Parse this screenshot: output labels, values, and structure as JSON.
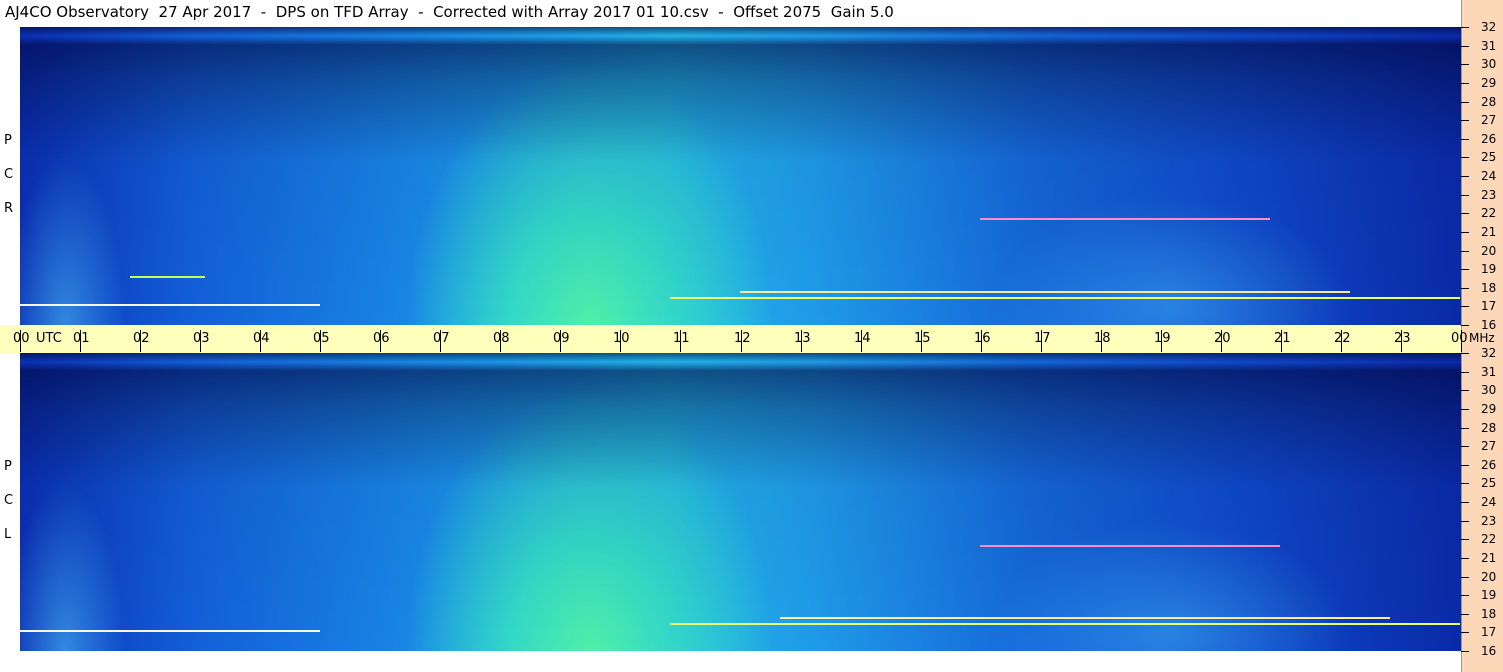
{
  "title": "AJ4CO Observatory  27 Apr 2017  -  DPS on TFD Array  -  Corrected with Array 2017 01 10.csv  -  Offset 2075  Gain 5.0",
  "chart_data": {
    "type": "heatmap",
    "x_axis": {
      "unit": "UTC",
      "range": [
        0,
        24
      ],
      "tick_labels": [
        "00",
        "01",
        "02",
        "03",
        "04",
        "05",
        "06",
        "07",
        "08",
        "09",
        "10",
        "11",
        "12",
        "13",
        "14",
        "15",
        "16",
        "17",
        "18",
        "19",
        "20",
        "21",
        "22",
        "23",
        "00"
      ],
      "first_label_suffix": "UTC"
    },
    "y_axis": {
      "unit": "MHz",
      "range": [
        16,
        32
      ],
      "tick_labels": [
        "32",
        "31",
        "30",
        "29",
        "28",
        "27",
        "26",
        "25",
        "24",
        "23",
        "22",
        "21",
        "20",
        "19",
        "18",
        "17",
        "16"
      ]
    },
    "panels": [
      {
        "label_letters": [
          "P",
          "C",
          "R"
        ]
      },
      {
        "label_letters": [
          "P",
          "C",
          "L"
        ]
      }
    ],
    "colors": {
      "low": "#000a50",
      "mid": "#1a8ee8",
      "high": "#4ff0a8",
      "axis_band": "#ffffbc",
      "mhz_strip": "#fdd8b8"
    }
  }
}
